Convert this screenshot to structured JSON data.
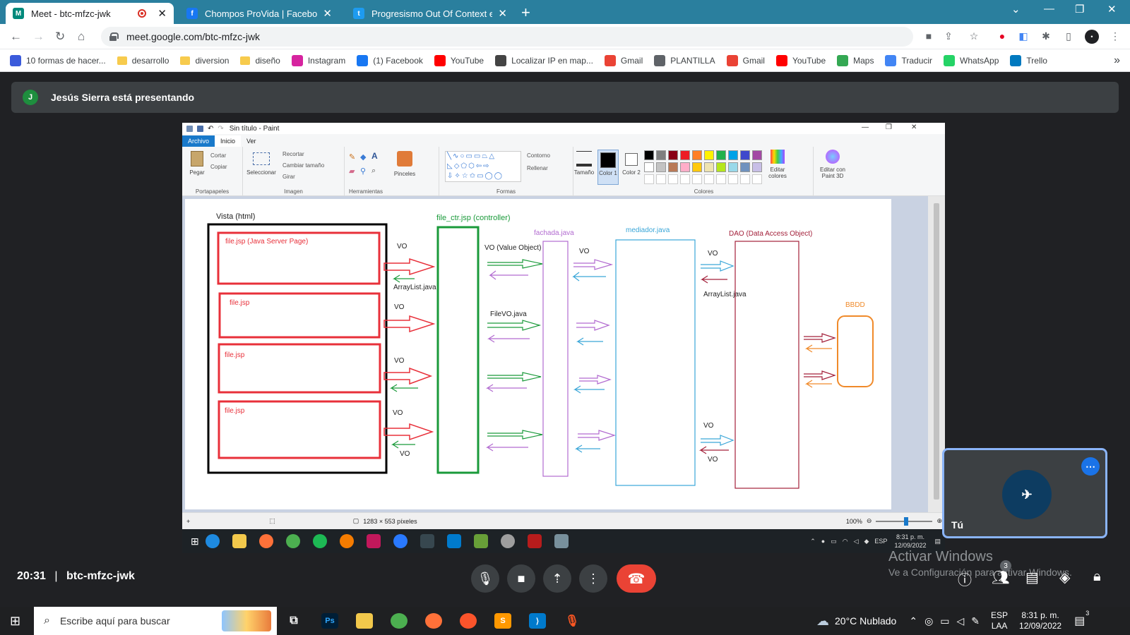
{
  "browser": {
    "tabs": [
      {
        "title": "Meet - btc-mfzc-jwk",
        "active": true,
        "favicon": "meet-icon",
        "color": "#00897b"
      },
      {
        "title": "Chompos ProVida | Facebook",
        "active": false,
        "favicon": "facebook-icon",
        "color": "#1877f2"
      },
      {
        "title": "Progresismo Out Of Context en T",
        "active": false,
        "favicon": "twitter-icon",
        "color": "#1d9bf0"
      }
    ],
    "url": "meet.google.com/btc-mfzc-jwk",
    "bookmarks": [
      {
        "label": "10 formas de hacer...",
        "icon": "mh-icon",
        "color": "#3b5bdb"
      },
      {
        "label": "desarrollo",
        "icon": "folder-icon"
      },
      {
        "label": "diversion",
        "icon": "folder-icon"
      },
      {
        "label": "diseño",
        "icon": "folder-icon"
      },
      {
        "label": "Instagram",
        "icon": "instagram-icon",
        "color": "#d6249f"
      },
      {
        "label": "(1) Facebook",
        "icon": "facebook-icon",
        "color": "#1877f2"
      },
      {
        "label": "YouTube",
        "icon": "youtube-icon",
        "color": "#ff0000"
      },
      {
        "label": "Localizar IP en map...",
        "icon": "ip-icon",
        "color": "#444444"
      },
      {
        "label": "Gmail",
        "icon": "gmail-icon",
        "color": "#ea4335"
      },
      {
        "label": "PLANTILLA",
        "icon": "globe-icon",
        "color": "#5f6368"
      },
      {
        "label": "Gmail",
        "icon": "gmail-icon",
        "color": "#ea4335"
      },
      {
        "label": "YouTube",
        "icon": "youtube-icon",
        "color": "#ff0000"
      },
      {
        "label": "Maps",
        "icon": "maps-icon",
        "color": "#34a853"
      },
      {
        "label": "Traducir",
        "icon": "translate-icon",
        "color": "#4285f4"
      },
      {
        "label": "WhatsApp",
        "icon": "whatsapp-icon",
        "color": "#25d366"
      },
      {
        "label": "Trello",
        "icon": "trello-icon",
        "color": "#0079bf"
      }
    ]
  },
  "meet": {
    "presenter_initial": "J",
    "presenter_text": "Jesús Sierra está presentando",
    "time": "20:31",
    "separator": "|",
    "code": "btc-mfzc-jwk",
    "self_label": "Tú",
    "participants_badge": "3",
    "end_color": "#ea4335"
  },
  "paint": {
    "title": "Sin título - Paint",
    "menu": [
      "Archivo",
      "Inicio",
      "Ver"
    ],
    "groups": {
      "clipboard": "Portapapeles",
      "image": "Imagen",
      "tools": "Herramientas",
      "shapes": "Formas",
      "colors": "Colores"
    },
    "buttons": {
      "paste": "Pegar",
      "cut": "Cortar",
      "copy": "Copiar",
      "select": "Seleccionar",
      "crop": "Recortar",
      "resize": "Cambiar tamaño",
      "rotate": "Girar",
      "brushes": "Pinceles",
      "outline": "Contorno",
      "fill": "Rellenar",
      "size": "Tamaño",
      "color1": "Color 1",
      "color2": "Color 2",
      "edit_colors": "Editar colores",
      "paint3d": "Editar con Paint 3D"
    },
    "palette": [
      "#000000",
      "#7f7f7f",
      "#880015",
      "#ed1c24",
      "#ff7f27",
      "#fff200",
      "#22b14c",
      "#00a2e8",
      "#3f48cc",
      "#a349a4",
      "#ffffff",
      "#c3c3c3",
      "#b97a57",
      "#ffaec9",
      "#ffc90e",
      "#efe4b0",
      "#b5e61d",
      "#99d9ea",
      "#7092be",
      "#c8bfe7"
    ],
    "status_size": "1283 × 553 píxeles",
    "zoom": "100%"
  },
  "diagram": {
    "vista_title": "Vista (html)",
    "pages": [
      "file.jsp (Java Server Page)",
      "file.jsp",
      "file.jsp",
      "file.jsp"
    ],
    "controller": "file_ctr.jsp (controller)",
    "facade": "fachada.java",
    "mediator": "mediador.java",
    "dao": "DAO (Data Access Object)",
    "db": "BBDD",
    "vo": "VO",
    "vo_value": "VO (Value Object)",
    "arraylist": "ArrayList.java",
    "filevo": "FileVO.java",
    "colors": {
      "red": "#e8303a",
      "green": "#1a9a3a",
      "purple": "#b26bd0",
      "blue": "#3aa6d8",
      "darkred": "#a3203a",
      "orange": "#f08a2a"
    }
  },
  "overlay": {
    "watermark_title": "Activar Windows",
    "watermark_sub": "Ve a Configuración para activar Windows."
  },
  "inner_tray": {
    "lang": "ESP",
    "time": "8:31 p. m.",
    "date": "12/09/2022"
  },
  "taskbar": {
    "search_placeholder": "Escribe aquí para buscar",
    "weather": "20°C  Nublado",
    "lang1": "ESP",
    "lang2": "LAA",
    "time": "8:31 p. m.",
    "date": "12/09/2022",
    "notif": "3"
  }
}
